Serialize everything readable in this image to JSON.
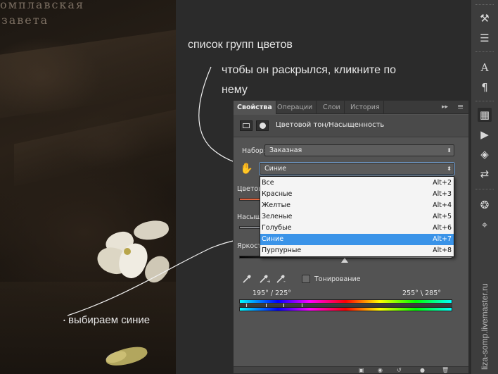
{
  "photo": {
    "title_line1": "омплавская",
    "title_line2": "завета"
  },
  "annotations": {
    "color_groups_list": "список групп цветов",
    "click_to_open": "чтобы он раскрылся, кликните по",
    "click_to_open_2": "нему",
    "choose_blue": "выбираем  синие"
  },
  "panel": {
    "tabs": [
      {
        "label": "Свойства",
        "active": true
      },
      {
        "label": "Операции",
        "active": false
      },
      {
        "label": "Слои",
        "active": false
      },
      {
        "label": "История",
        "active": false
      }
    ],
    "tabbar_controls": "▸▸",
    "menu_icon": "≡",
    "adjustment_title": "Цветовой тон/Насыщенность",
    "preset_label": "Набор:",
    "preset_value": "Заказная",
    "channel_value": "Синие",
    "hue_label": "Цветов",
    "saturation_label": "Насыщ",
    "lightness_label": "Яркост",
    "colorize_label": "Тонирование",
    "range_left": "195° / 225°",
    "range_right": "255° \\ 285°",
    "channel_options": [
      {
        "name": "Все",
        "shortcut": "Alt+2",
        "selected": false
      },
      {
        "name": "Красные",
        "shortcut": "Alt+3",
        "selected": false
      },
      {
        "name": "Желтые",
        "shortcut": "Alt+4",
        "selected": false
      },
      {
        "name": "Зеленые",
        "shortcut": "Alt+5",
        "selected": false
      },
      {
        "name": "Голубые",
        "shortcut": "Alt+6",
        "selected": false
      },
      {
        "name": "Синие",
        "shortcut": "Alt+7",
        "selected": true
      },
      {
        "name": "Пурпурные",
        "shortcut": "Alt+8",
        "selected": false
      }
    ]
  },
  "toolstrip": {
    "icons": [
      "brushes-icon",
      "sliders-icon",
      "character-icon",
      "paragraph-icon",
      "properties-icon",
      "play-icon",
      "layers-icon",
      "history-icon",
      "channels-icon",
      "paths-icon"
    ]
  },
  "watermark": "liza-somp.livemaster.ru"
}
